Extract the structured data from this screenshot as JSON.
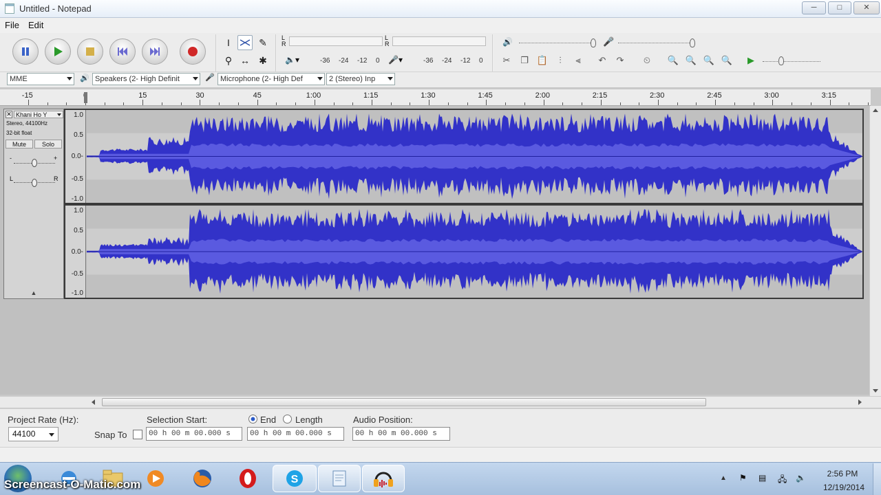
{
  "window": {
    "title": "Untitled - Notepad",
    "minimize": "─",
    "maximize": "□",
    "close": "✕"
  },
  "menu": [
    "File",
    "Edit"
  ],
  "transport": {
    "pause": "pause-icon",
    "play": "play-icon",
    "stop": "stop-icon",
    "skip_start": "skip-start-icon",
    "skip_end": "skip-end-icon",
    "record": "record-icon"
  },
  "meters": {
    "lr_top": "L\nR",
    "ticks": [
      "-36",
      "-24",
      "-12",
      "0"
    ]
  },
  "devices": {
    "host": "MME",
    "output": "Speakers (2- High Definit",
    "input": "Microphone (2- High Def",
    "channels": "2 (Stereo) Inp"
  },
  "ruler": [
    "-15",
    "0",
    "15",
    "30",
    "45",
    "1:00",
    "1:15",
    "1:30",
    "1:45",
    "2:00",
    "2:15",
    "2:30",
    "2:45",
    "3:00",
    "3:15"
  ],
  "track": {
    "name": "Khani Ho Y",
    "info1": "Stereo, 44100Hz",
    "info2": "32-bit float",
    "mute": "Mute",
    "solo": "Solo",
    "gain_minus": "-",
    "gain_plus": "+",
    "pan_l": "L",
    "pan_r": "R",
    "collapse": "▲",
    "scale": [
      "1.0",
      "0.5",
      "0.0-",
      "-0.5",
      "-1.0"
    ]
  },
  "selection": {
    "project_rate_label": "Project Rate (Hz):",
    "project_rate": "44100",
    "snap_to": "Snap To",
    "selection_start_label": "Selection Start:",
    "end_label": "End",
    "length_label": "Length",
    "audio_position_label": "Audio Position:",
    "start_value": "00 h 00 m 00.000 s",
    "end_value": "00 h 00 m 00.000 s",
    "position_value": "00 h 00 m 00.000 s"
  },
  "taskbar": {
    "watermark": "Screencast-O-Matic.com",
    "time": "2:56 PM",
    "date": "12/19/2014"
  },
  "colors": {
    "waveform": "#3232c8",
    "waveform_light": "#6464dc"
  }
}
